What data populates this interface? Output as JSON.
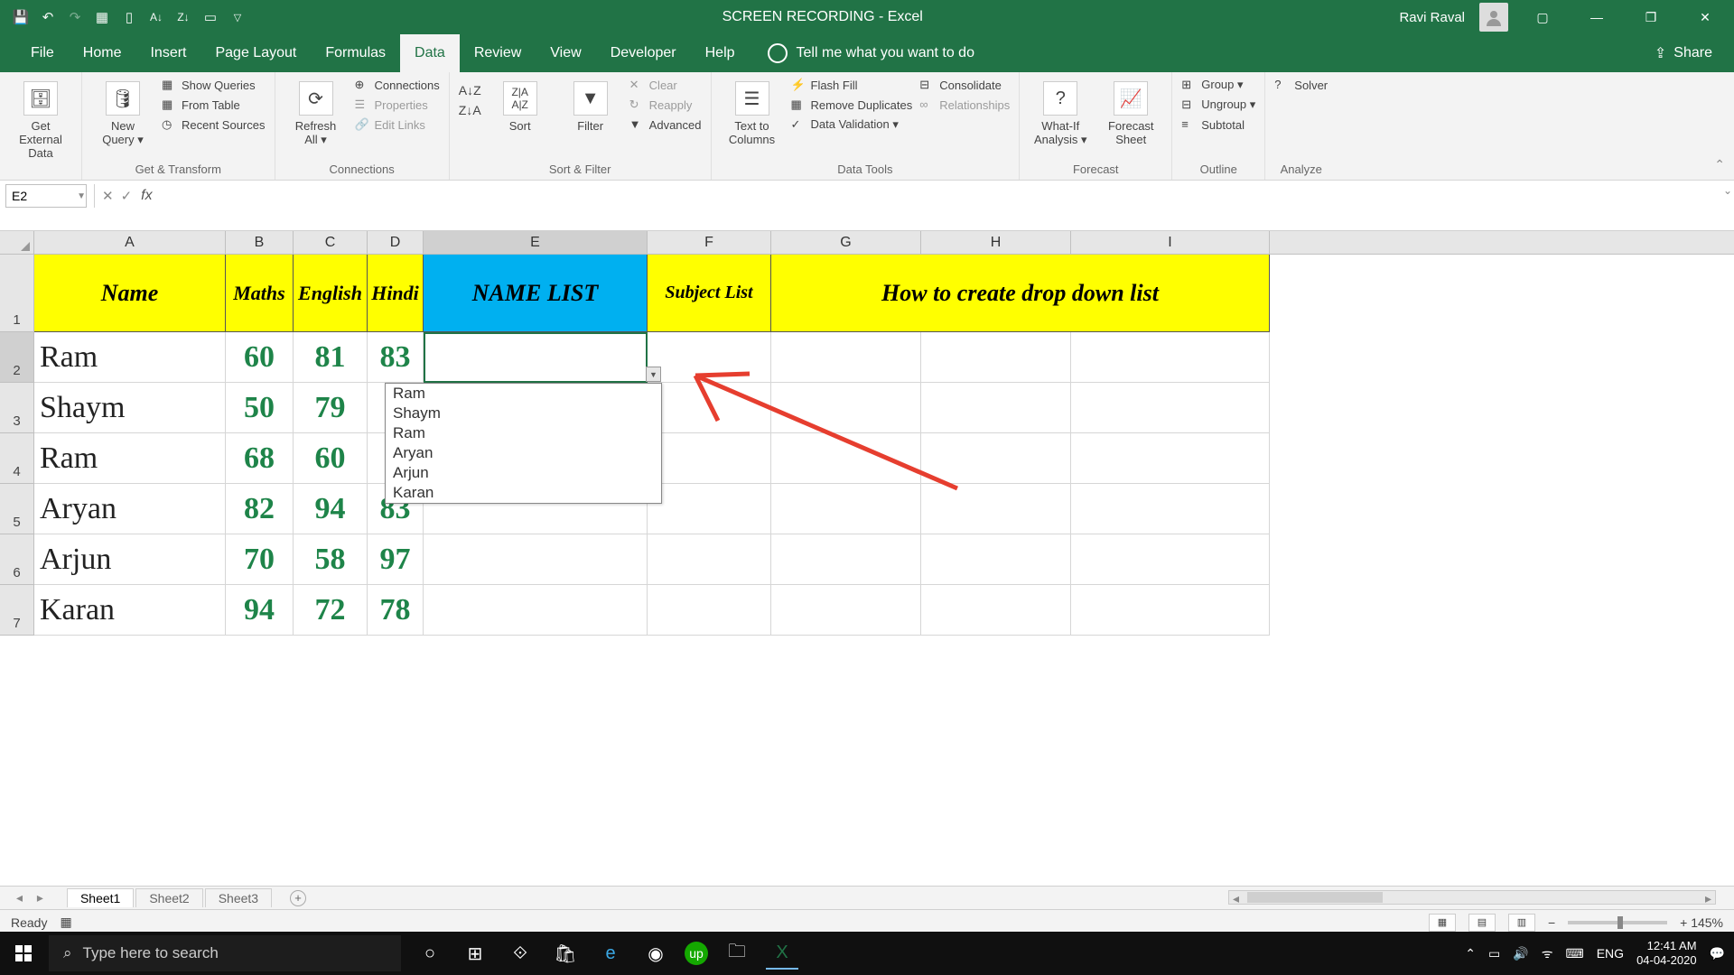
{
  "titlebar": {
    "title": "SCREEN RECORDING  -  Excel",
    "user": "Ravi Raval"
  },
  "tabs": {
    "file": "File",
    "home": "Home",
    "insert": "Insert",
    "pagelayout": "Page Layout",
    "formulas": "Formulas",
    "data": "Data",
    "review": "Review",
    "view": "View",
    "developer": "Developer",
    "help": "Help",
    "tellme": "Tell me what you want to do",
    "share": "Share"
  },
  "ribbon": {
    "g1": {
      "label": "Get External Data ▾",
      "btn": "Get External\nData"
    },
    "g2": {
      "label": "Get & Transform",
      "new": "New\nQuery ▾",
      "i1": "Show Queries",
      "i2": "From Table",
      "i3": "Recent Sources"
    },
    "g3": {
      "label": "Connections",
      "refresh": "Refresh\nAll ▾",
      "i1": "Connections",
      "i2": "Properties",
      "i3": "Edit Links"
    },
    "g4": {
      "label": "Sort & Filter",
      "sort": "Sort",
      "filter": "Filter",
      "i1": "Clear",
      "i2": "Reapply",
      "i3": "Advanced"
    },
    "g5": {
      "label": "Data Tools",
      "ttc": "Text to\nColumns",
      "i1": "Flash Fill",
      "i2": "Remove Duplicates",
      "i3": "Data Validation  ▾",
      "i4": "Consolidate",
      "i5": "Relationships"
    },
    "g6": {
      "label": "Forecast",
      "wi": "What-If\nAnalysis ▾",
      "fs": "Forecast\nSheet"
    },
    "g7": {
      "label": "Outline",
      "i1": "Group  ▾",
      "i2": "Ungroup  ▾",
      "i3": "Subtotal"
    },
    "g8": {
      "label": "Analyze",
      "i1": "Solver"
    }
  },
  "namebox": "E2",
  "columns": [
    "A",
    "B",
    "C",
    "D",
    "E",
    "F",
    "G",
    "H",
    "I"
  ],
  "headers": {
    "A": "Name",
    "B": "Maths",
    "C": "English",
    "D": "Hindi",
    "E": "NAME LIST",
    "F": "Subject List",
    "GHI": "How to create drop down list"
  },
  "rows": [
    {
      "n": "2",
      "A": "Ram",
      "B": "60",
      "C": "81",
      "D": "83"
    },
    {
      "n": "3",
      "A": "Shaym",
      "B": "50",
      "C": "79",
      "D": ""
    },
    {
      "n": "4",
      "A": "Ram",
      "B": "68",
      "C": "60",
      "D": ""
    },
    {
      "n": "5",
      "A": "Aryan",
      "B": "82",
      "C": "94",
      "D": "83"
    },
    {
      "n": "6",
      "A": "Arjun",
      "B": "70",
      "C": "58",
      "D": "97"
    },
    {
      "n": "7",
      "A": "Karan",
      "B": "94",
      "C": "72",
      "D": "78"
    }
  ],
  "dropdown": [
    "Ram",
    "Shaym",
    "Ram",
    "Aryan",
    "Arjun",
    "Karan"
  ],
  "sheets": {
    "s1": "Sheet1",
    "s2": "Sheet2",
    "s3": "Sheet3"
  },
  "status": {
    "ready": "Ready",
    "zoom": "+  145%"
  },
  "taskbar": {
    "search": "Type here to search",
    "lang": "ENG",
    "time": "12:41 AM",
    "date": "04-04-2020"
  }
}
